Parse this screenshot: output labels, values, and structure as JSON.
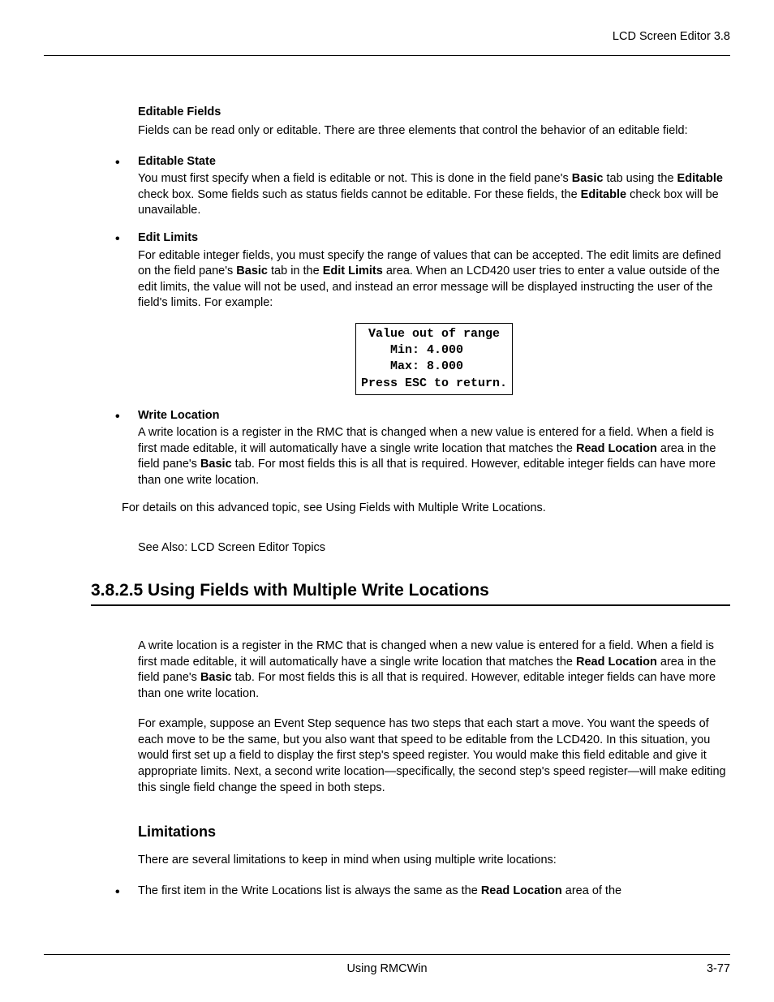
{
  "header": {
    "right": "LCD Screen Editor  3.8"
  },
  "section1": {
    "heading": "Editable Fields",
    "intro": "Fields can be read only or editable. There are three elements that control the behavior of an editable field:",
    "bullets": [
      {
        "title": "Editable State",
        "body_parts": [
          "You must first specify when a field is editable or not. This is done in the field pane's ",
          "Basic",
          " tab using the ",
          "Editable",
          " check box. Some fields such as status fields cannot be editable. For these fields, the ",
          "Editable",
          " check box will be unavailable."
        ]
      },
      {
        "title": "Edit Limits",
        "body_parts": [
          "For editable integer fields, you must specify the range of values that can be accepted. The edit limits are defined on the field pane's ",
          "Basic",
          " tab in the ",
          "Edit Limits",
          " area. When an LCD420 user tries to enter a value outside of the edit limits, the value will not be used, and instead an error message will be displayed instructing the user of the field's limits. For example:"
        ]
      },
      {
        "title": "Write Location",
        "body_parts": [
          "A write location is a register in the RMC that is changed when a new value is entered for a field. When a field is first made editable, it will automatically have a single write location that matches the ",
          "Read Location",
          " area in the field pane's ",
          "Basic",
          " tab. For most fields this is all that is required. However, editable integer fields can have more than one write location."
        ]
      }
    ],
    "lcd_lines": [
      " Value out of range ",
      "    Min: 4.000      ",
      "    Max: 8.000      ",
      "Press ESC to return."
    ],
    "details": "For details on this advanced topic, see Using Fields with Multiple Write Locations.",
    "see_also": "See Also: LCD Screen Editor Topics"
  },
  "section2": {
    "heading": "3.8.2.5  Using Fields with Multiple Write Locations",
    "para1_parts": [
      "A write location is a register in the RMC that is changed when a new value is entered for a field. When a field is first made editable, it will automatically have a single write location that matches the ",
      "Read Location",
      " area in the field pane's ",
      "Basic",
      " tab. For most fields this is all that is required. However, editable integer fields can have more than one write location."
    ],
    "para2": "For example, suppose an Event Step sequence has two steps that each start a move. You want the speeds of each move to be the same, but you also want that speed to be editable from the LCD420. In this situation, you would first set up a field to display the first step's speed register. You would make this field editable and give it appropriate limits. Next, a second write location—specifically, the second step's speed register—will make editing this single field change the speed in both steps.",
    "sub_heading": "Limitations",
    "para3": "There are several limitations to keep in mind when using multiple write locations:",
    "last_bullet_parts": [
      "The first item in the Write Locations list is always the same as the ",
      "Read Location",
      " area of the"
    ]
  },
  "footer": {
    "center": "Using RMCWin",
    "right": "3-77"
  }
}
